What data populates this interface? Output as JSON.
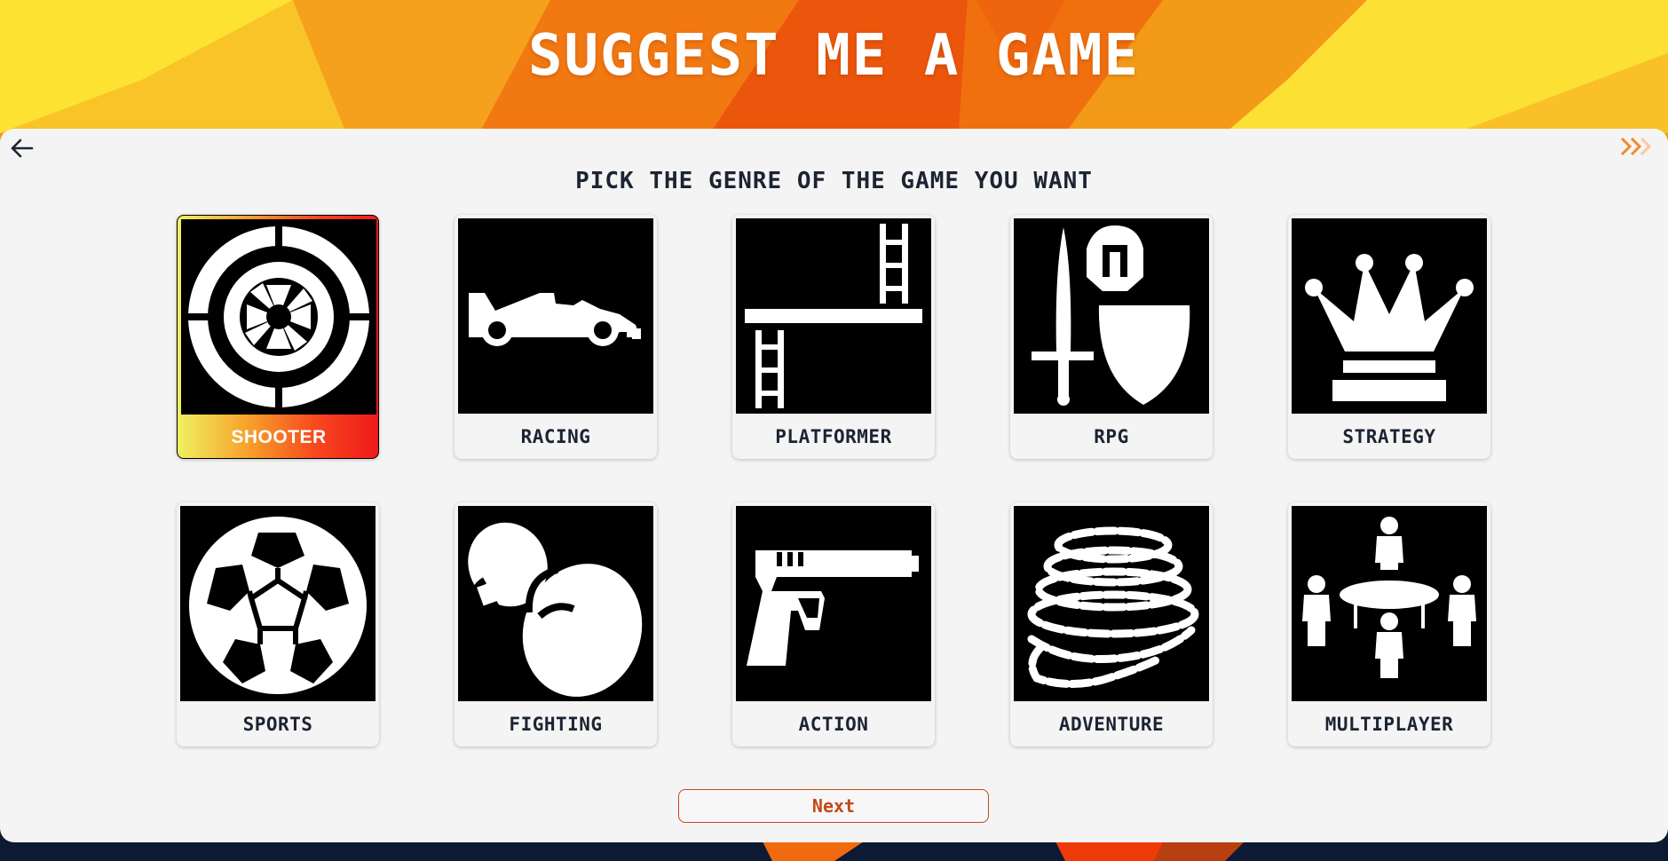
{
  "header": {
    "title": "SUGGEST ME A GAME"
  },
  "nav": {
    "back_icon": "arrow-left-icon",
    "skip_icon": "double-chevron-right-icon"
  },
  "prompt": "PICK THE GENRE OF THE GAME YOU WANT",
  "genres": [
    {
      "label": "SHOOTER",
      "icon": "crosshair-icon",
      "selected": true
    },
    {
      "label": "RACING",
      "icon": "race-car-icon",
      "selected": false
    },
    {
      "label": "PLATFORMER",
      "icon": "ladder-platform-icon",
      "selected": false
    },
    {
      "label": "RPG",
      "icon": "sword-shield-icon",
      "selected": false
    },
    {
      "label": "STRATEGY",
      "icon": "crown-icon",
      "selected": false
    },
    {
      "label": "SPORTS",
      "icon": "soccer-ball-icon",
      "selected": false
    },
    {
      "label": "FIGHTING",
      "icon": "boxing-glove-icon",
      "selected": false
    },
    {
      "label": "ACTION",
      "icon": "pistol-icon",
      "selected": false
    },
    {
      "label": "ADVENTURE",
      "icon": "stone-tower-icon",
      "selected": false
    },
    {
      "label": "MULTIPLAYER",
      "icon": "round-table-icon",
      "selected": false
    }
  ],
  "next_button": {
    "label": "Next"
  },
  "colors": {
    "accent": "#c2491a",
    "header_bg_light": "#fde232",
    "header_bg_dark": "#ef5a0c",
    "text_dark": "#1c2433",
    "selected_gradient_start": "#f0f060",
    "selected_gradient_end": "#ef1a1a"
  }
}
